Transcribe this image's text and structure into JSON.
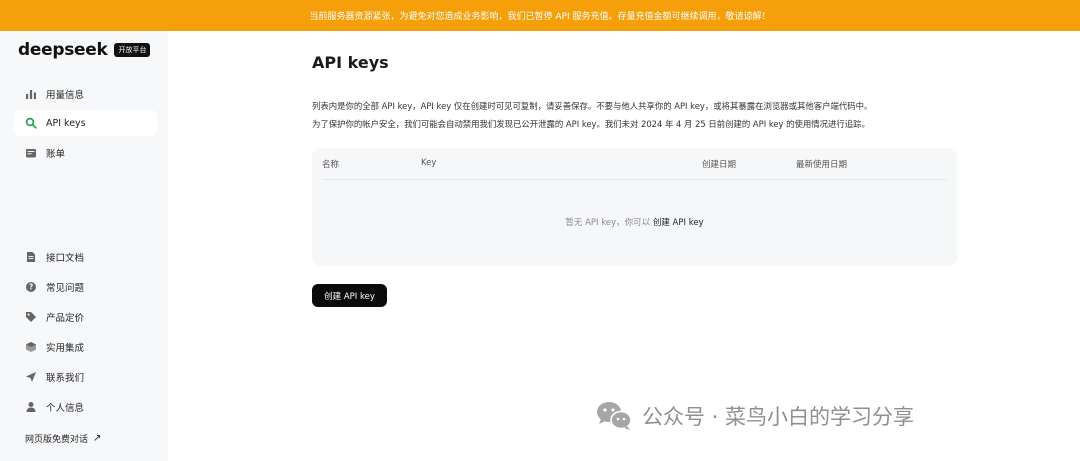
{
  "banner": {
    "text": "当前服务器资源紧张，为避免对您造成业务影响，我们已暂停 API 服务充值。存量充值金额可继续调用，敬请谅解！",
    "color": "#f59f0b"
  },
  "sidebar": {
    "logo_text": "deepseek",
    "logo_badge": "开放平台",
    "top_items": [
      {
        "label": "用量信息",
        "icon": "bar-chart-icon"
      },
      {
        "label": "API keys",
        "icon": "search-icon",
        "active": true
      },
      {
        "label": "账单",
        "icon": "wallet-icon"
      }
    ],
    "bottom_items": [
      {
        "label": "接口文档",
        "icon": "document-icon"
      },
      {
        "label": "常见问题",
        "icon": "question-icon"
      },
      {
        "label": "产品定价",
        "icon": "tag-icon"
      },
      {
        "label": "实用集成",
        "icon": "cube-icon"
      },
      {
        "label": "联系我们",
        "icon": "send-icon"
      },
      {
        "label": "个人信息",
        "icon": "user-icon"
      }
    ],
    "web_link": "网页版免费对话",
    "web_link_icon": "external-arrow-icon"
  },
  "main": {
    "title": "API keys",
    "desc_line1": "列表内是你的全部 API key，API key 仅在创建时可见可复制，请妥善保存。不要与他人共享你的 API key，或将其暴露在浏览器或其他客户端代码中。",
    "desc_line2": "为了保护你的帐户安全，我们可能会自动禁用我们发现已公开泄露的 API key。我们未对 2024 年 4 月 25 日前创建的 API key 的使用情况进行追踪。",
    "table": {
      "columns": [
        "名称",
        "Key",
        "创建日期",
        "最新使用日期"
      ],
      "empty_text": "暂无 API key，你可以",
      "empty_link": "创建 API key"
    },
    "create_button": "创建 API key"
  },
  "watermark": {
    "text": "公众号 · 菜鸟小白的学习分享",
    "icon": "wechat-icon"
  }
}
